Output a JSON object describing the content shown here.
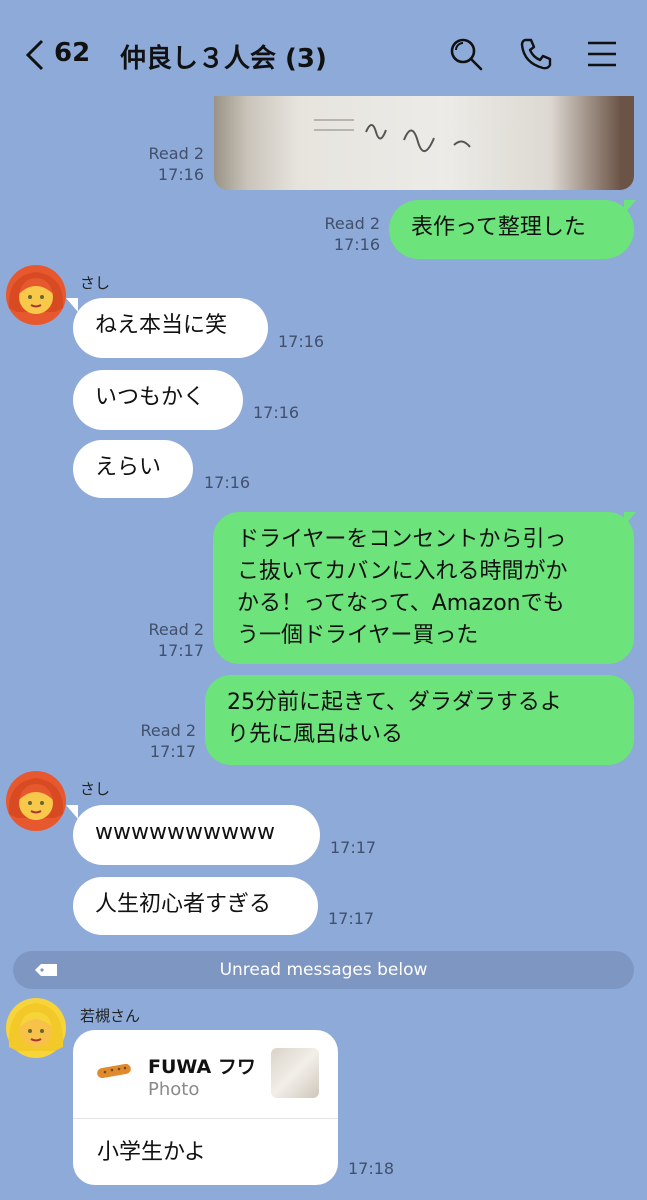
{
  "header": {
    "back_count": "62",
    "title": "仲良し３人会 (3)",
    "icons": [
      "chevron-left-icon",
      "search-icon",
      "phone-icon",
      "menu-icon"
    ]
  },
  "messages": [
    {
      "type": "photo",
      "direction": "out",
      "status": "Read 2",
      "time": "17:16"
    },
    {
      "type": "text",
      "direction": "out",
      "status": "Read 2",
      "time": "17:16",
      "text": "表作って整理した"
    },
    {
      "type": "text",
      "direction": "in",
      "sender": "さし",
      "time": "17:16",
      "text": "ねえ本当に笑"
    },
    {
      "type": "text",
      "direction": "in",
      "time": "17:16",
      "text": "いつもかく"
    },
    {
      "type": "text",
      "direction": "in",
      "time": "17:16",
      "text": "えらい"
    },
    {
      "type": "text",
      "direction": "out",
      "status": "Read 2",
      "time": "17:17",
      "lines": [
        "ドライヤーをコンセントから引っ",
        "こ抜いてカバンに入れる時間がか",
        "かる！ってなって、Amazonでも",
        "う一個ドライヤー買った"
      ]
    },
    {
      "type": "text",
      "direction": "out",
      "status": "Read 2",
      "time": "17:17",
      "lines": [
        "25分前に起きて、ダラダラするよ",
        "り先に風呂はいる"
      ]
    },
    {
      "type": "text",
      "direction": "in",
      "sender": "さし",
      "time": "17:17",
      "text": "wwwwwwwwww"
    },
    {
      "type": "text",
      "direction": "in",
      "time": "17:17",
      "text": "人生初心者すぎる"
    }
  ],
  "unread_divider": "Unread messages below",
  "reply_card": {
    "sender": "若槻さん",
    "quoted_title": "FUWA フワ",
    "quoted_sub": "Photo",
    "text": "小学生かよ",
    "time": "17:18"
  },
  "colors": {
    "background": "#8DAAD9",
    "outgoing": "#6DE37B",
    "incoming": "#FFFFFF"
  }
}
